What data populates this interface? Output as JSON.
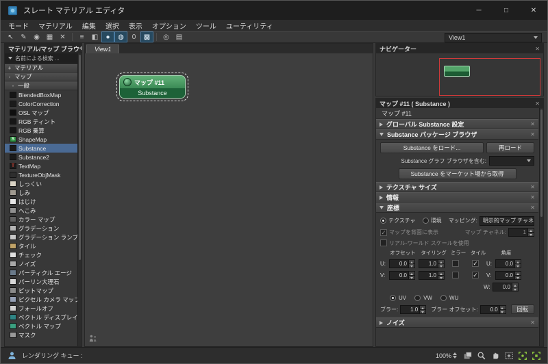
{
  "window": {
    "title": "スレート マテリアル エディタ",
    "minimize": "─",
    "maximize": "□",
    "close": "✕"
  },
  "menu": {
    "items": [
      "モード",
      "マテリアル",
      "編集",
      "選択",
      "表示",
      "オプション",
      "ツール",
      "ユーティリティ"
    ]
  },
  "toolbar": {
    "view_selector": "View1",
    "tools": [
      {
        "name": "select",
        "glyph": "↖"
      },
      {
        "name": "pick-material",
        "glyph": "✎"
      },
      {
        "name": "assign-material",
        "glyph": "◉"
      },
      {
        "name": "put-to-library",
        "glyph": "▦"
      },
      {
        "name": "delete",
        "glyph": "✕"
      },
      {
        "name": "layout-all",
        "glyph": "≡"
      },
      {
        "name": "hide-unused-nodeslots",
        "glyph": "◧"
      },
      {
        "name": "show-end-result",
        "glyph": "●"
      },
      {
        "name": "show-shaded-material",
        "glyph": "◍"
      },
      {
        "name": "show-background",
        "glyph": "0"
      },
      {
        "name": "material-id-channel",
        "glyph": "▩"
      },
      {
        "name": "select-by-material",
        "glyph": "◎"
      },
      {
        "name": "options",
        "glyph": "▤"
      }
    ]
  },
  "browser": {
    "title": "マテリアル/マップ ブラウザ",
    "search_label": "名前による検索 ...",
    "groups": [
      {
        "expander": "+",
        "label": "マテリアル"
      },
      {
        "expander": "-",
        "label": "マップ"
      },
      {
        "expander": "-",
        "label": "一般"
      }
    ],
    "selected_item": "Substance",
    "items": [
      {
        "label": "BlendedBoxMap",
        "swatch": "#161616"
      },
      {
        "label": "ColorCorrection",
        "swatch": "#1b1b1b"
      },
      {
        "label": "OSL マップ",
        "swatch": "#0f0f0f"
      },
      {
        "label": "RGB ティント",
        "swatch": "#161616"
      },
      {
        "label": "RGB 乗算",
        "swatch": "#161616"
      },
      {
        "label": "ShapeMap",
        "swatch": "#2e8f42",
        "glyph": "S",
        "glyph_color": "#dfffdf"
      },
      {
        "label": "Substance",
        "swatch": "#1a1a1a"
      },
      {
        "label": "Substance2",
        "swatch": "#1a1a1a"
      },
      {
        "label": "TextMap",
        "swatch": "#1c1c1c",
        "glyph": "T",
        "glyph_color": "#d5493a"
      },
      {
        "label": "TextureObjMask",
        "swatch": "#2e2e2e"
      },
      {
        "label": "しっくい",
        "swatch": "#d8d2c4"
      },
      {
        "label": "しみ",
        "swatch": "#a09a90"
      },
      {
        "label": "はじけ",
        "swatch": "#e6e6e6"
      },
      {
        "label": "へこみ",
        "swatch": "#909090"
      },
      {
        "label": "カラー マップ",
        "swatch": "#606060"
      },
      {
        "label": "グラデーション",
        "swatch": "#b5b5b5"
      },
      {
        "label": "グラデーション ランプ",
        "swatch": "#c8c8c8"
      },
      {
        "label": "タイル",
        "swatch": "#bfa267"
      },
      {
        "label": "チェック",
        "swatch": "#e0e0e0"
      },
      {
        "label": "ノイズ",
        "swatch": "#a8a8a8"
      },
      {
        "label": "パーティクル エージ",
        "swatch": "#6a7a8a"
      },
      {
        "label": "パーリン大理石",
        "swatch": "#d8d8d8"
      },
      {
        "label": "ビットマップ",
        "swatch": "#8a8a8a"
      },
      {
        "label": "ピクセル カメラ マップ",
        "swatch": "#95a0b5"
      },
      {
        "label": "フォールオフ",
        "swatch": "#d0d0d0"
      },
      {
        "label": "ベクトル ディスプレイ...",
        "swatch": "#2f8585"
      },
      {
        "label": "ベクトル マップ",
        "swatch": "#3aa080"
      },
      {
        "label": "マスク",
        "swatch": "#9a9a9a"
      }
    ]
  },
  "canvas": {
    "tab": "View1",
    "node": {
      "title": "マップ #11",
      "subtitle": "Substance"
    }
  },
  "navigator": {
    "title": "ナビゲーター"
  },
  "params": {
    "title": "マップ #11 ( Substance )",
    "name_field": "マップ #11",
    "rollout_global": "グローバル Substance 設定",
    "rollout_package": "Substance パッケージ ブラウザ",
    "load_button": "Substance をロード...",
    "reload_button": "再ロード",
    "graph_browser_label": "Substance グラフ ブラウザを含む:",
    "market_button": "Substance をマーケット場から取得",
    "rollout_texture_size": "テクスチャ サイズ",
    "rollout_info": "情報",
    "rollout_coords": "座標",
    "rollout_noise": "ノイズ",
    "coords": {
      "texture_radio": "テクスチャ",
      "environ_radio": "環境",
      "mapping_label": "マッピング:",
      "mapping_value": "明示的マップ チャネル",
      "show_back_label": "マップを背面に表示",
      "map_channel_label": "マップ チャネル:",
      "map_channel_value": "1",
      "real_world_label": "リアル-ワールド スケールを使用",
      "headers": [
        "オフセット",
        "タイリング",
        "ミラー",
        "タイル",
        "角度"
      ],
      "row_u_label": "U:",
      "row_v_label": "V:",
      "row_w_label": "W:",
      "u_offset": "0.0",
      "u_tiling": "1.0",
      "u_angle": "0.0",
      "v_offset": "0.0",
      "v_tiling": "1.0",
      "v_angle": "0.0",
      "w_angle": "0.0",
      "uv_label": "UV",
      "vw_label": "VW",
      "wu_label": "WU",
      "blur_label": "ブラー:",
      "blur_value": "1.0",
      "blur_offset_label": "ブラー オフセット:",
      "blur_offset_value": "0.0",
      "rotate_button": "回転",
      "check_glyph": "✓"
    }
  },
  "statusbar": {
    "queue_label": "レンダリング キュー :",
    "zoom": "100%"
  }
}
